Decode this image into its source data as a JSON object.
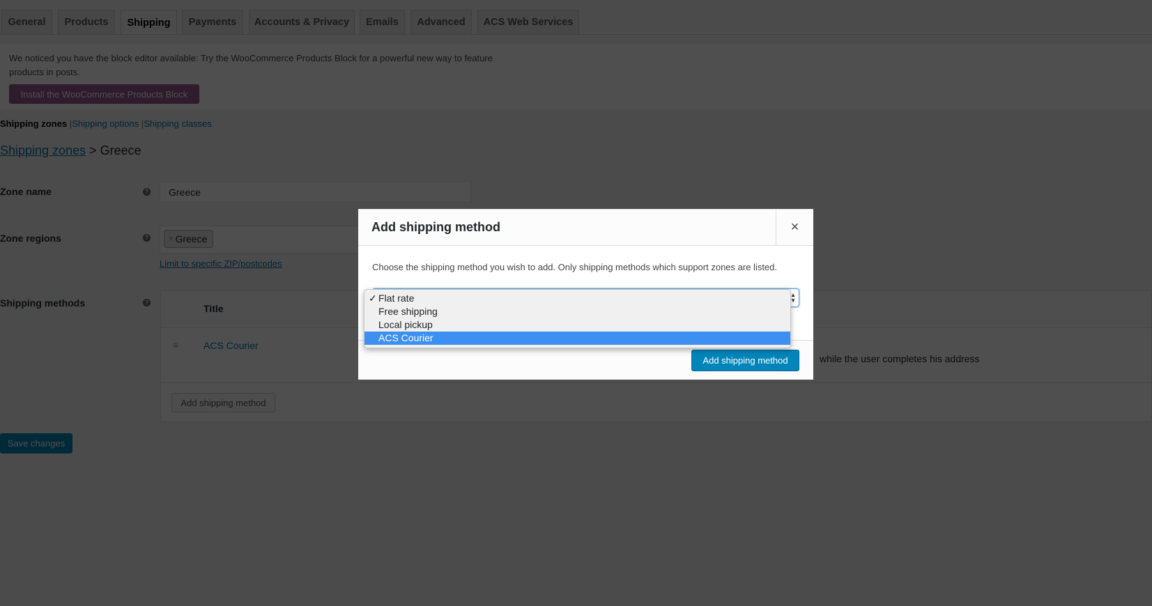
{
  "tabs": [
    "General",
    "Products",
    "Shipping",
    "Payments",
    "Accounts & Privacy",
    "Emails",
    "Advanced",
    "ACS Web Services"
  ],
  "active_tab": "Shipping",
  "notice": {
    "text": "We noticed you have the block editor available: Try the WooCommerce Products Block for a powerful new way to feature products in posts.",
    "button": "Install the WooCommerce Products Block"
  },
  "subnav": {
    "current": "Shipping zones",
    "separator": "|",
    "links": [
      "Shipping options",
      "Shipping classes"
    ]
  },
  "breadcrumb": {
    "link": "Shipping zones",
    "separator": ">",
    "current": "Greece"
  },
  "form": {
    "zone_name_label": "Zone name",
    "zone_name_value": "Greece",
    "zone_regions_label": "Zone regions",
    "region_chip": "Greece",
    "chip_remove": "×",
    "limit_link": "Limit to specific ZIP/postcodes",
    "shipping_methods_label": "Shipping methods",
    "help": "?",
    "table": {
      "header_title": "Title",
      "rows": [
        {
          "title": "ACS Courier",
          "description_fragment": "while the user completes his address"
        }
      ],
      "add_button": "Add shipping method"
    },
    "save": "Save changes"
  },
  "modal": {
    "title": "Add shipping method",
    "close": "×",
    "description": "Choose the shipping method you wish to add. Only shipping methods which support zones are listed.",
    "options": [
      "Flat rate",
      "Free shipping",
      "Local pickup",
      "ACS Courier"
    ],
    "checked": "✓",
    "highlighted": "ACS Courier",
    "submit": "Add shipping method"
  },
  "colors": {
    "accent": "#0085ba",
    "woo": "#96588a",
    "highlight": "#3d8ff2",
    "link": "#0073aa"
  }
}
